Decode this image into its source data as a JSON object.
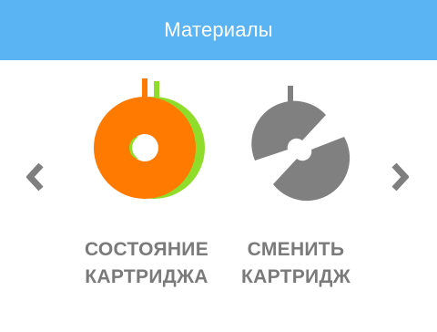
{
  "header": {
    "title": "Материалы"
  },
  "navigation": {
    "prev_icon": "chevron-left-icon",
    "next_icon": "chevron-right-icon"
  },
  "tiles": [
    {
      "icon": "cartridge-status-icon",
      "label_line1": "СОСТОЯНИЕ",
      "label_line2": "КАРТРИДЖА"
    },
    {
      "icon": "cartridge-swap-icon",
      "label_line1": "СМЕНИТЬ",
      "label_line2": "КАРТРИДЖ"
    }
  ],
  "colors": {
    "header": "#5ab3f2",
    "spool_primary": "#ff7a00",
    "spool_secondary": "#8fdc2a",
    "icon_gray": "#808080",
    "label_gray": "#7a7a7a"
  }
}
